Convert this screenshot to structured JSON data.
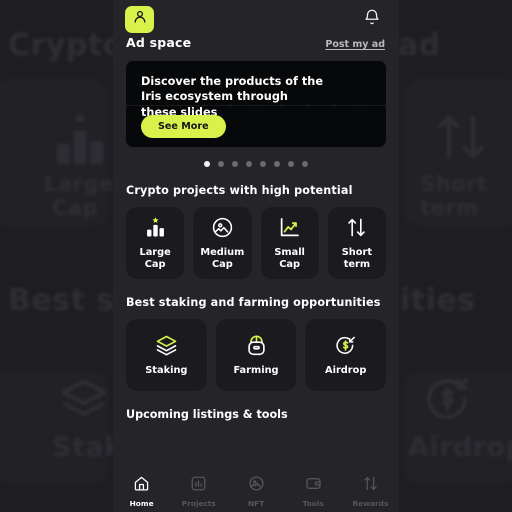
{
  "header": {
    "avatar_icon": "person-icon",
    "notification_icon": "bell-icon",
    "ad_title": "Ad space",
    "post_link": "Post my ad"
  },
  "banner": {
    "text": "Discover the products of the Iris ecosystem through these slides",
    "cta_label": "See More",
    "accent_color": "#d9f24b",
    "background_color": "#07080a"
  },
  "carousel": {
    "total": 8,
    "active_index": 0
  },
  "sections": [
    {
      "heading": "Crypto projects with high potential",
      "cards": [
        {
          "label": "Large\nCap",
          "label_line1": "Large",
          "label_line2": "Cap",
          "icon": "bar-chart-star-icon"
        },
        {
          "label": "Medium\nCap",
          "label_line1": "Medium",
          "label_line2": "Cap",
          "icon": "image-circle-icon"
        },
        {
          "label": "Small\nCap",
          "label_line1": "Small",
          "label_line2": "Cap",
          "icon": "line-chart-icon"
        },
        {
          "label": "Short\nterm",
          "label_line1": "Short",
          "label_line2": "term",
          "icon": "arrows-up-down-icon"
        }
      ]
    },
    {
      "heading": "Best staking and farming opportunities",
      "cards": [
        {
          "label_line1": "Staking",
          "icon": "layers-icon"
        },
        {
          "label_line1": "Farming",
          "icon": "basket-icon"
        },
        {
          "label_line1": "Airdrop",
          "icon": "dollar-refresh-icon"
        }
      ]
    }
  ],
  "bottom_heading": "Upcoming listings & tools",
  "nav": [
    {
      "label": "Home",
      "icon": "home-icon",
      "active": true
    },
    {
      "label": "Projects",
      "icon": "chart-icon",
      "active": false
    },
    {
      "label": "NFT",
      "icon": "image-icon",
      "active": false
    },
    {
      "label": "Tools",
      "icon": "wallet-icon",
      "active": false
    },
    {
      "label": "Rewards",
      "icon": "transfer-icon",
      "active": false
    }
  ],
  "backdrop": {
    "words": [
      "Crypto p",
      "ad",
      "Large",
      "Cap",
      "Short",
      "term",
      "Best stak",
      "ities",
      "Staki",
      "Airdrop"
    ]
  },
  "colors": {
    "accent": "#d9f24b",
    "panel_bg": "#252529",
    "card_bg": "#1b1b1f",
    "page_bg": "#1e1e22",
    "text_primary": "#ffffff",
    "text_muted": "#55555d"
  }
}
